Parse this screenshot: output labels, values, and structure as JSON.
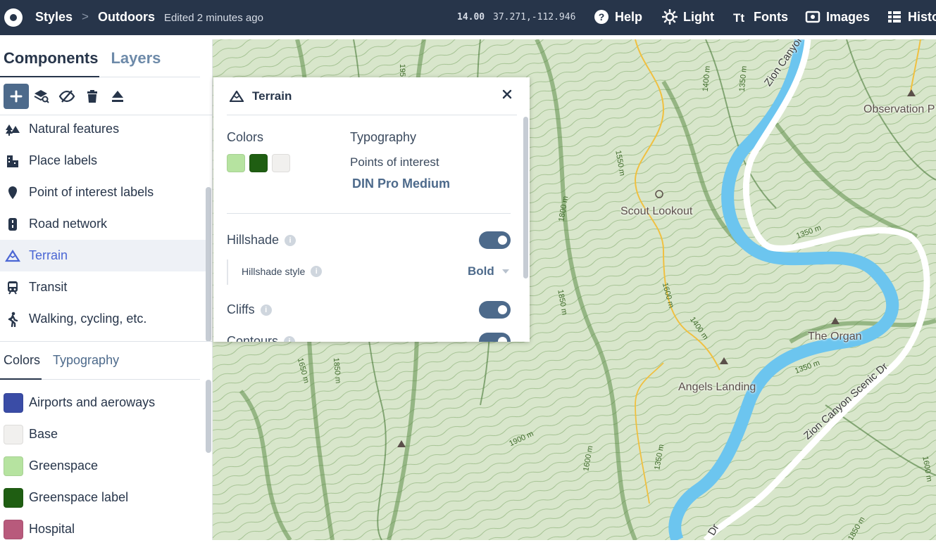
{
  "header": {
    "breadcrumb_root": "Styles",
    "breadcrumb_separator": ">",
    "style_name": "Outdoors",
    "edited_text": "Edited 2 minutes ago",
    "zoom": "14.00",
    "coordinates": "37.271,-112.946",
    "buttons": {
      "help": "Help",
      "light": "Light",
      "fonts": "Fonts",
      "images": "Images",
      "history": "Histo"
    }
  },
  "sidebar": {
    "tabs": [
      "Components",
      "Layers"
    ],
    "active_tab": "Components",
    "components": [
      {
        "label": "Natural features",
        "icon": "natural-features-icon"
      },
      {
        "label": "Place labels",
        "icon": "place-labels-icon"
      },
      {
        "label": "Point of interest labels",
        "icon": "poi-pin-icon"
      },
      {
        "label": "Road network",
        "icon": "road-icon"
      },
      {
        "label": "Terrain",
        "icon": "terrain-icon",
        "selected": true
      },
      {
        "label": "Transit",
        "icon": "transit-icon"
      },
      {
        "label": "Walking, cycling, etc.",
        "icon": "walking-icon"
      }
    ],
    "subtabs": [
      "Colors",
      "Typography"
    ],
    "active_subtab": "Colors",
    "colors": [
      {
        "label": "Airports and aeroways",
        "color": "#3a4ca6"
      },
      {
        "label": "Base",
        "color": "#f1f0ee"
      },
      {
        "label": "Greenspace",
        "color": "#b6e3a0"
      },
      {
        "label": "Greenspace label",
        "color": "#1f5e12"
      },
      {
        "label": "Hospital",
        "color": "#b85a7c"
      }
    ]
  },
  "panel": {
    "title": "Terrain",
    "colors_heading": "Colors",
    "swatches": [
      "#b6e3a0",
      "#1f5e12",
      "#f1f0ee"
    ],
    "typography_heading": "Typography",
    "typography_item": "Points of interest",
    "font_name": "DIN Pro Medium",
    "hillshade_label": "Hillshade",
    "hillshade_style_label": "Hillshade style",
    "hillshade_style_value": "Bold",
    "cliffs_label": "Cliffs",
    "contours_label": "Contours",
    "hillshade_on": true,
    "cliffs_on": true,
    "contours_on": true
  },
  "map": {
    "labels": {
      "scout": "Scout Lookout",
      "angels": "Angels Landing",
      "organ": "The Organ",
      "observation": "Observation P",
      "road_top": "Zion Canyon Scen",
      "road_bottom": "Zion Canyon Scenic Dr",
      "road_dr": "Dr"
    },
    "contours": [
      "1400 m",
      "1350 m",
      "1550 m",
      "1800 m",
      "1850 m",
      "1600 m",
      "1400 m",
      "1350 m",
      "1350 m",
      "1650 m",
      "1850 m",
      "1900 m",
      "1600 m",
      "1350 m",
      "1600 m",
      "1850 m",
      "195"
    ]
  }
}
